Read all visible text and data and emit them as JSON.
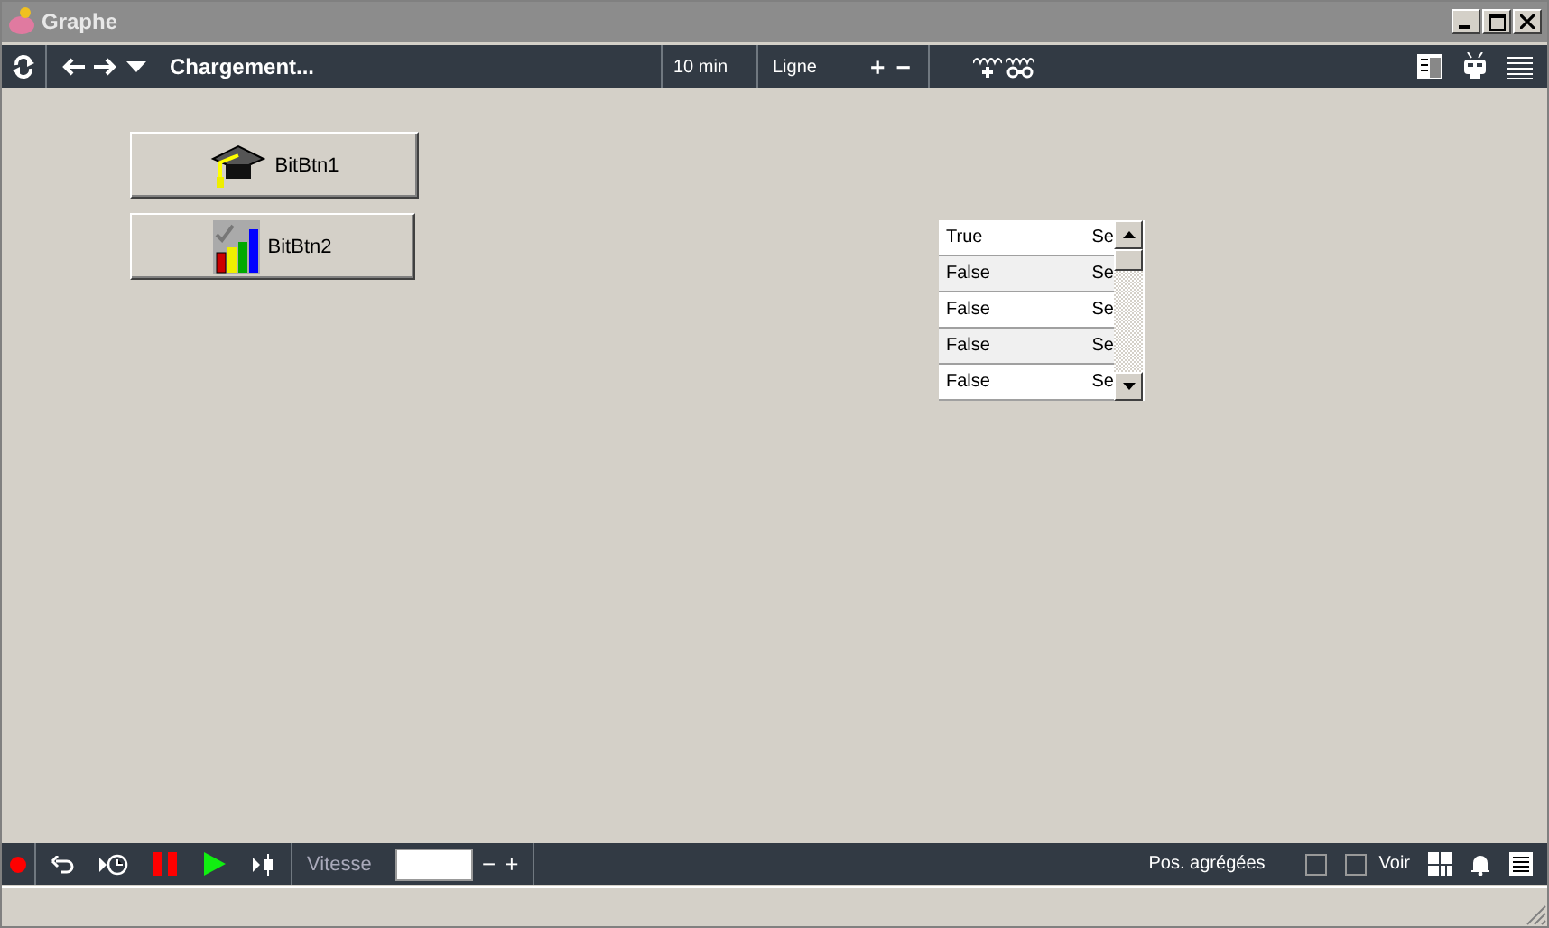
{
  "window": {
    "title": "Graphe"
  },
  "toolbar": {
    "title": "Chargement...",
    "period": "10 min",
    "mode": "Ligne",
    "zoom_in": "+",
    "zoom_out": "−"
  },
  "buttons": [
    {
      "label": "BitBtn1",
      "kind": "cap"
    },
    {
      "label": "BitBtn2",
      "kind": "chart"
    }
  ],
  "grid": {
    "rows": [
      {
        "column_1": "True",
        "column_2": "Se"
      },
      {
        "column_1": "False",
        "column_2": "Se"
      },
      {
        "column_1": "False",
        "column_2": "Se"
      },
      {
        "column_1": "False",
        "column_2": "Se"
      },
      {
        "column_1": "False",
        "column_2": "Se"
      }
    ]
  },
  "bottom_bar": {
    "speed_label": "Vitesse",
    "speed_minus": "−",
    "speed_plus": "+",
    "options": [
      {
        "label": "Pos. agrégées",
        "checked": false
      },
      {
        "label": "Voir",
        "checked": false
      }
    ]
  }
}
